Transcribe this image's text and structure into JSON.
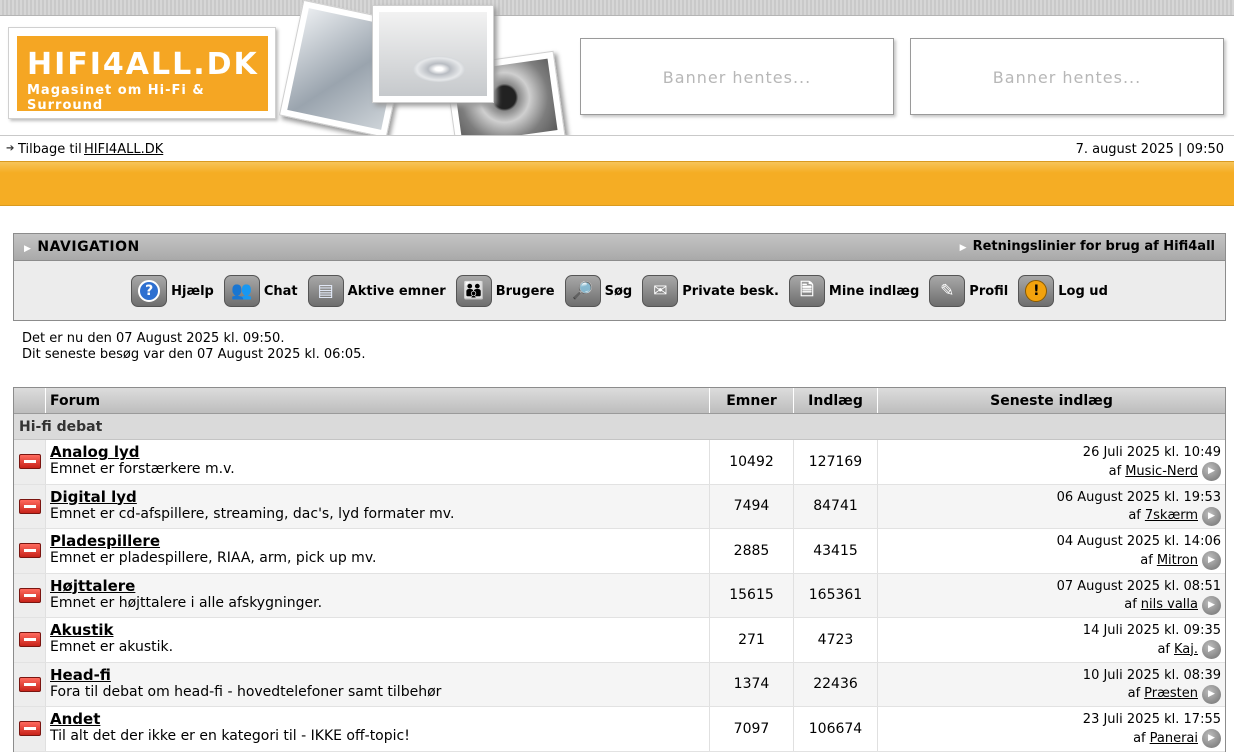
{
  "header": {
    "logo_title": "HIFI4ALL.DK",
    "logo_subtitle": "Magasinet om Hi-Fi & Surround",
    "banners": [
      "Banner hentes...",
      "Banner hentes..."
    ],
    "back_text": "Tilbage til",
    "back_link": "HIFI4ALL.DK",
    "datetime": "7. august 2025 | 09:50"
  },
  "colors": {
    "accent": "#f5ad24",
    "nav_header": "#b5b5b5"
  },
  "navigation": {
    "title": "NAVIGATION",
    "rules_link": "Retningslinier for brug af Hifi4all",
    "items": [
      {
        "label": "Hjælp",
        "icon": "help-icon"
      },
      {
        "label": "Chat",
        "icon": "chat-icon"
      },
      {
        "label": "Aktive emner",
        "icon": "active-topics-icon"
      },
      {
        "label": "Brugere",
        "icon": "users-icon"
      },
      {
        "label": "Søg",
        "icon": "search-icon"
      },
      {
        "label": "Private besk.",
        "icon": "private-message-icon"
      },
      {
        "label": "Mine indlæg",
        "icon": "my-posts-icon"
      },
      {
        "label": "Profil",
        "icon": "profile-icon"
      },
      {
        "label": "Log ud",
        "icon": "logout-icon"
      }
    ]
  },
  "info": {
    "now": "Det er nu den 07 August 2025 kl. 09:50.",
    "last_visit": "Dit seneste besøg var den 07 August 2025 kl. 06:05."
  },
  "table": {
    "headers": [
      "Forum",
      "Emner",
      "Indlæg",
      "Seneste indlæg"
    ],
    "category": "Hi-fi debat",
    "rows": [
      {
        "name": "Analog lyd",
        "desc": "Emnet er forstærkere m.v.",
        "topics": "10492",
        "posts": "127169",
        "last_date": "26 Juli 2025 kl. 10:49",
        "by": "af",
        "user": "Music-Nerd"
      },
      {
        "name": "Digital lyd",
        "desc": "Emnet er cd-afspillere, streaming, dac's, lyd formater mv.",
        "topics": "7494",
        "posts": "84741",
        "last_date": "06 August 2025 kl. 19:53",
        "by": "af",
        "user": "7skærm"
      },
      {
        "name": "Pladespillere",
        "desc": "Emnet er pladespillere, RIAA, arm, pick up mv.",
        "topics": "2885",
        "posts": "43415",
        "last_date": "04 August 2025 kl. 14:06",
        "by": "af",
        "user": "Mitron"
      },
      {
        "name": "Højttalere",
        "desc": "Emnet er højttalere i alle afskygninger.",
        "topics": "15615",
        "posts": "165361",
        "last_date": "07 August 2025 kl. 08:51",
        "by": "af",
        "user": "nils valla"
      },
      {
        "name": "Akustik",
        "desc": "Emnet er akustik.",
        "topics": "271",
        "posts": "4723",
        "last_date": "14 Juli 2025 kl. 09:35",
        "by": "af",
        "user": "Kaj."
      },
      {
        "name": "Head-fi",
        "desc": "Fora til debat om head-fi - hovedtelefoner samt tilbehør",
        "topics": "1374",
        "posts": "22436",
        "last_date": "10 Juli 2025 kl. 08:39",
        "by": "af",
        "user": "Præsten"
      },
      {
        "name": "Andet",
        "desc": "Til alt det der ikke er en kategori til - IKKE off-topic!",
        "topics": "7097",
        "posts": "106674",
        "last_date": "23 Juli 2025 kl. 17:55",
        "by": "af",
        "user": "Panerai"
      }
    ]
  }
}
